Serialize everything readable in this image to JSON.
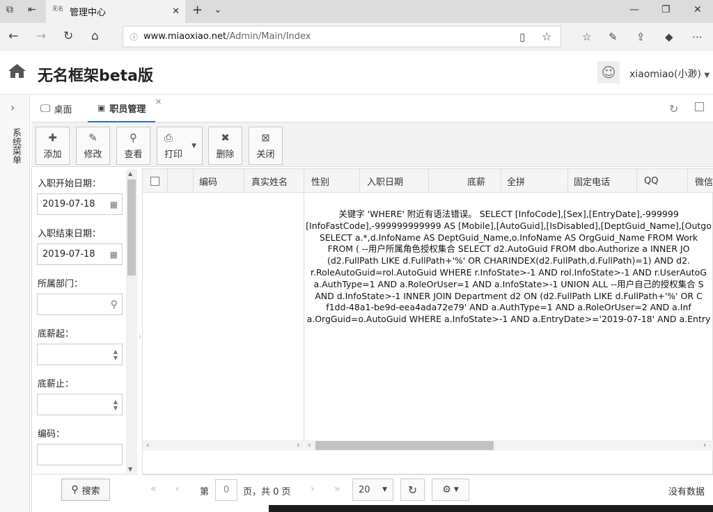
{
  "browser": {
    "tab_title": "管理中心",
    "tab_favicon": "无名",
    "url_host": "www.miaoxiao.net",
    "url_path": "/Admin/Main/Index"
  },
  "app": {
    "title": "无名框架beta版",
    "user": "xiaomiao(小渺)",
    "side_menu": "系统菜单"
  },
  "tabs": [
    {
      "label": "桌面"
    },
    {
      "label": "职员管理"
    }
  ],
  "toolbar": [
    {
      "label": "添加",
      "icon": "plus-icon"
    },
    {
      "label": "修改",
      "icon": "pencil-icon"
    },
    {
      "label": "查看",
      "icon": "search-icon"
    },
    {
      "label": "打印",
      "icon": "print-icon"
    },
    {
      "label": "删除",
      "icon": "close-icon"
    },
    {
      "label": "关闭",
      "icon": "close-box-icon"
    }
  ],
  "filters": [
    {
      "label": "入职开始日期：",
      "value": "2019-07-18"
    },
    {
      "label": "入职结束日期：",
      "value": "2019-07-18"
    },
    {
      "label": "所属部门：",
      "value": ""
    },
    {
      "label": "底薪起：",
      "value": ""
    },
    {
      "label": "底薪止：",
      "value": ""
    },
    {
      "label": "编码：",
      "value": ""
    }
  ],
  "search_label": "搜索",
  "columns": [
    "编码",
    "真实姓名",
    "性别",
    "入职日期",
    "底薪",
    "全拼",
    "固定电话",
    "QQ",
    "微信"
  ],
  "error": "关键字 'WHERE' 附近有语法错误。 SELECT [InfoCode],[Sex],[EntryDate],-999999\n[InfoFastCode],-999999999999 AS [Mobile],[AutoGuid],[IsDisabled],[DeptGuid_Name],[Outgo\nSELECT a.*,d.InfoName AS DeptGuid_Name,o.InfoName AS OrgGuid_Name FROM Work\nFROM ( --用户所属角色授权集合 SELECT d2.AutoGuid FROM dbo.Authorize a INNER JO\n(d2.FullPath LIKE d.FullPath+'%' OR CHARINDEX(d2.FullPath,d.FullPath)=1) AND d2.\nr.RoleAutoGuid=rol.AutoGuid WHERE r.InfoState>-1 AND rol.InfoState>-1 AND r.UserAutoG\na.AuthType=1 AND a.RoleOrUser=1 AND a.InfoState>-1 UNION ALL --用户自己的授权集合 S\nAND d.InfoState>-1 INNER JOIN Department d2 ON (d2.FullPath LIKE d.FullPath+'%' OR C\nf1dd-48a1-be9d-eea4ada72e79' AND a.AuthType=1 AND a.RoleOrUser=2 AND a.Inf\na.OrgGuid=o.AutoGuid WHERE a.InfoState>-1 AND a.EntryDate>='2019-07-18' AND a.Entry",
  "pager": {
    "prefix": "第",
    "page": "0",
    "suffix": "页，共 0 页",
    "page_size": "20",
    "status": "没有数据"
  }
}
